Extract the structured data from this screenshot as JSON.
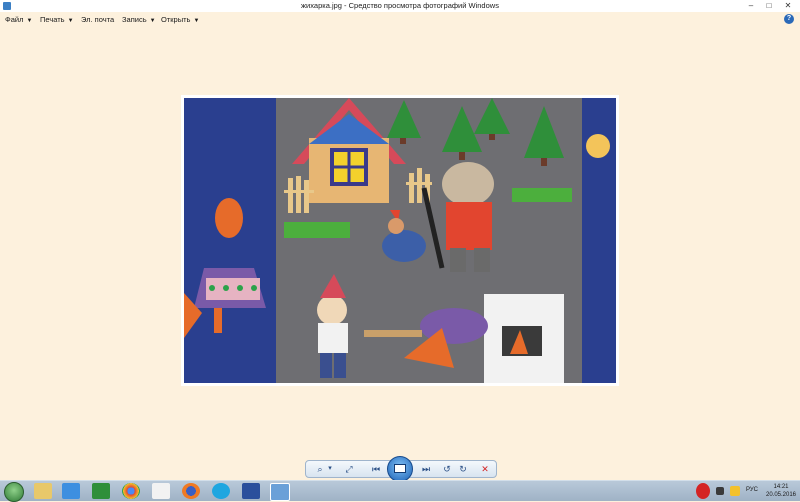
{
  "window": {
    "title": "жихарка.jpg - Средство просмотра фотографий Windows",
    "minimize_glyph": "–",
    "maximize_glyph": "□",
    "close_glyph": "✕"
  },
  "menu": {
    "items": [
      {
        "label": "Файл",
        "arrow": "▼"
      },
      {
        "label": "Печать",
        "arrow": "▼"
      },
      {
        "label": "Эл. почта",
        "arrow": ""
      },
      {
        "label": "Запись",
        "arrow": "▼"
      },
      {
        "label": "Открыть",
        "arrow": "▼"
      }
    ],
    "help_glyph": "?"
  },
  "photo": {
    "description_icon": "photo-image"
  },
  "controls": {
    "zoom_glyph": "⌕",
    "zoom_arrow": "▾",
    "fit_glyph": "⤢",
    "prev_glyph": "⏮",
    "next_glyph": "⏭",
    "rotate_ccw_glyph": "↺",
    "rotate_cw_glyph": "↻",
    "delete_glyph": "✕"
  },
  "taskbar": {
    "time": "14:21",
    "date": "20.05.2016",
    "language": "РУС",
    "pinned_icons": [
      "explorer-icon",
      "ie-icon",
      "excel-icon",
      "chrome-icon",
      "home-icon",
      "firefox-icon",
      "skype-icon",
      "sailboat-icon",
      "photo-viewer-icon"
    ]
  },
  "colors": {
    "background": "#fdf1dd",
    "accent": "#1a5fb4",
    "delete": "#d42424"
  }
}
